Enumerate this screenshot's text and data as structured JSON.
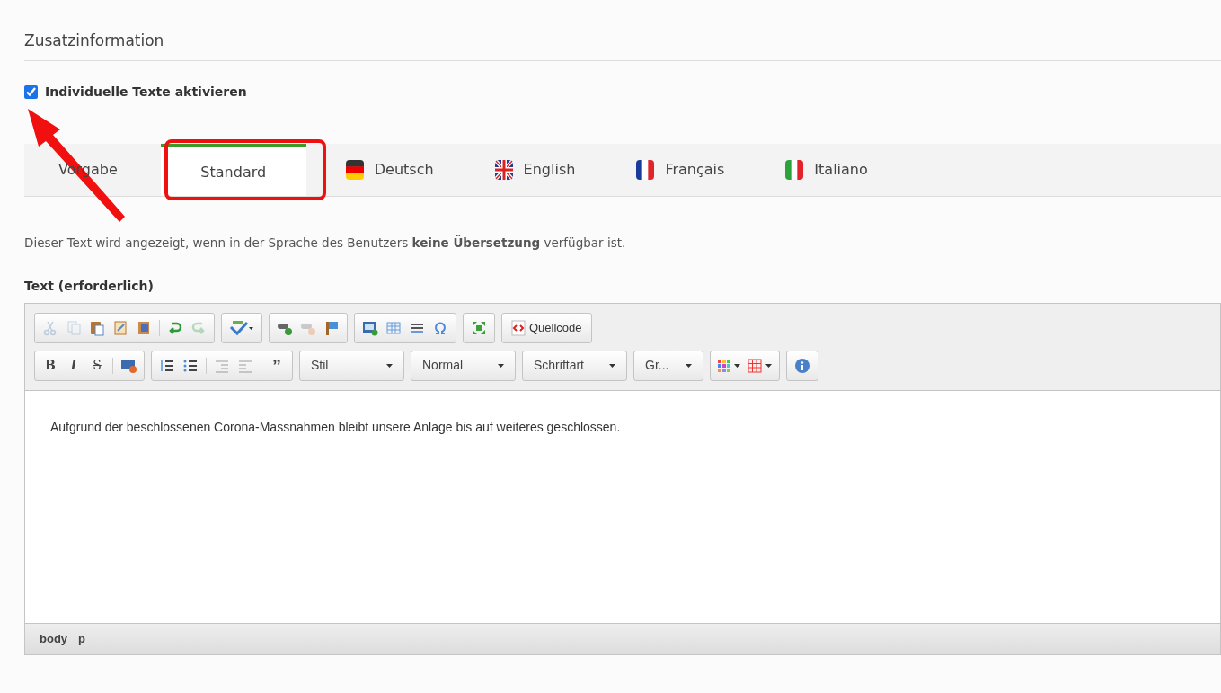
{
  "section": {
    "title": "Zusatzinformation"
  },
  "activation": {
    "label": "Individuelle Texte aktivieren",
    "checked": true
  },
  "tabs": [
    {
      "label": "Vorgabe",
      "kind": "plain",
      "selected": false
    },
    {
      "label": "Standard",
      "kind": "plain",
      "selected": true
    },
    {
      "label": "Deutsch",
      "kind": "de",
      "selected": false
    },
    {
      "label": "English",
      "kind": "gb",
      "selected": false
    },
    {
      "label": "Français",
      "kind": "fr",
      "selected": false
    },
    {
      "label": "Italiano",
      "kind": "it",
      "selected": false
    }
  ],
  "note": "Dieser Text wird angezeigt, wenn in der Sprache des Benutzers **keine Übersetzung** verfügbar ist.",
  "field_label": "Text (erforderlich)",
  "toolbar_row_1": [
    [
      {
        "kind": "cut",
        "disabled": true
      },
      {
        "kind": "copy",
        "disabled": true
      },
      {
        "kind": "paste",
        "disabled": false
      },
      {
        "kind": "paste-text",
        "disabled": false
      },
      {
        "kind": "paste-word",
        "disabled": false
      },
      {
        "kind": "sep"
      },
      {
        "kind": "undo",
        "disabled": false
      },
      {
        "kind": "redo",
        "disabled": true
      }
    ],
    [
      {
        "kind": "spellcheck",
        "disabled": false
      }
    ],
    [
      {
        "kind": "link",
        "disabled": false
      },
      {
        "kind": "unlink",
        "disabled": true
      },
      {
        "kind": "anchor",
        "disabled": false
      }
    ],
    [
      {
        "kind": "image",
        "disabled": false
      },
      {
        "kind": "table",
        "disabled": false
      },
      {
        "kind": "hr",
        "disabled": false
      },
      {
        "kind": "omega",
        "disabled": false
      }
    ],
    [
      {
        "kind": "maximize",
        "disabled": false
      }
    ],
    [
      {
        "kind": "source",
        "label": "Quellcode",
        "disabled": false
      }
    ]
  ],
  "toolbar_row_2": [
    [
      {
        "kind": "bold",
        "label": "B",
        "disabled": false
      },
      {
        "kind": "italic",
        "label": "I",
        "disabled": false
      },
      {
        "kind": "strike",
        "label": "S",
        "disabled": false
      },
      {
        "kind": "sep"
      },
      {
        "kind": "removeformat",
        "disabled": false
      }
    ],
    [
      {
        "kind": "ol",
        "disabled": false
      },
      {
        "kind": "ul",
        "disabled": false
      },
      {
        "kind": "sep"
      },
      {
        "kind": "outdent",
        "disabled": true
      },
      {
        "kind": "indent",
        "disabled": true
      },
      {
        "kind": "sep"
      },
      {
        "kind": "quote",
        "label": "”",
        "disabled": false
      }
    ]
  ],
  "dropdowns": [
    {
      "label": "Stil"
    },
    {
      "label": "Normal"
    },
    {
      "label": "Schriftart"
    },
    {
      "label": "Gr..."
    }
  ],
  "content": "Aufgrund der beschlossenen Corona-Massnahmen bleibt unsere Anlage bis auf weiteres geschlossen.",
  "path": [
    "body",
    "p"
  ]
}
